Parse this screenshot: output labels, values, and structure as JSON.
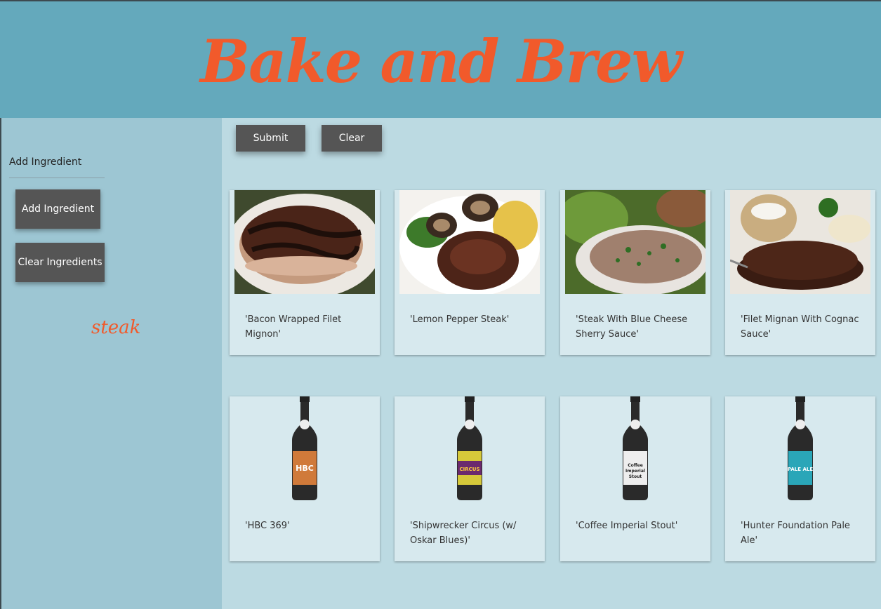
{
  "app": {
    "title": "Bake and Brew"
  },
  "sidebar": {
    "add_label": "Add Ingredient",
    "add_button": "Add Ingredient",
    "clear_button": "Clear Ingredients",
    "ingredients": [
      "steak"
    ]
  },
  "main": {
    "submit_label": "Submit",
    "clear_label": "Clear",
    "recipes": [
      {
        "name": "'Bacon Wrapped Filet Mignon'",
        "image": "bacon-wrapped-filet-photo"
      },
      {
        "name": "'Lemon Pepper Steak'",
        "image": "lemon-pepper-steak-photo"
      },
      {
        "name": "'Steak With Blue Cheese Sherry Sauce'",
        "image": "blue-cheese-steak-photo"
      },
      {
        "name": "'Filet Mignan With Cognac Sauce'",
        "image": "filet-cognac-photo"
      }
    ],
    "beers": [
      {
        "name": "'HBC 369'",
        "label_color": "#d07a3a",
        "label_text": "HBC"
      },
      {
        "name": "'Shipwrecker Circus (w/ Oskar Blues)'",
        "label_color": "#6b2a6e",
        "label_text": "CIRCUS"
      },
      {
        "name": "'Coffee Imperial Stout'",
        "label_color": "#eeeeee",
        "label_text": "Coffee Imperial Stout"
      },
      {
        "name": "'Hunter Foundation Pale Ale'",
        "label_color": "#2aa6b8",
        "label_text": "PALE ALE"
      }
    ]
  },
  "colors": {
    "accent": "#f15a2b",
    "header": "#64a9bc",
    "sidebar": "#9dc6d3",
    "button": "#555555"
  }
}
